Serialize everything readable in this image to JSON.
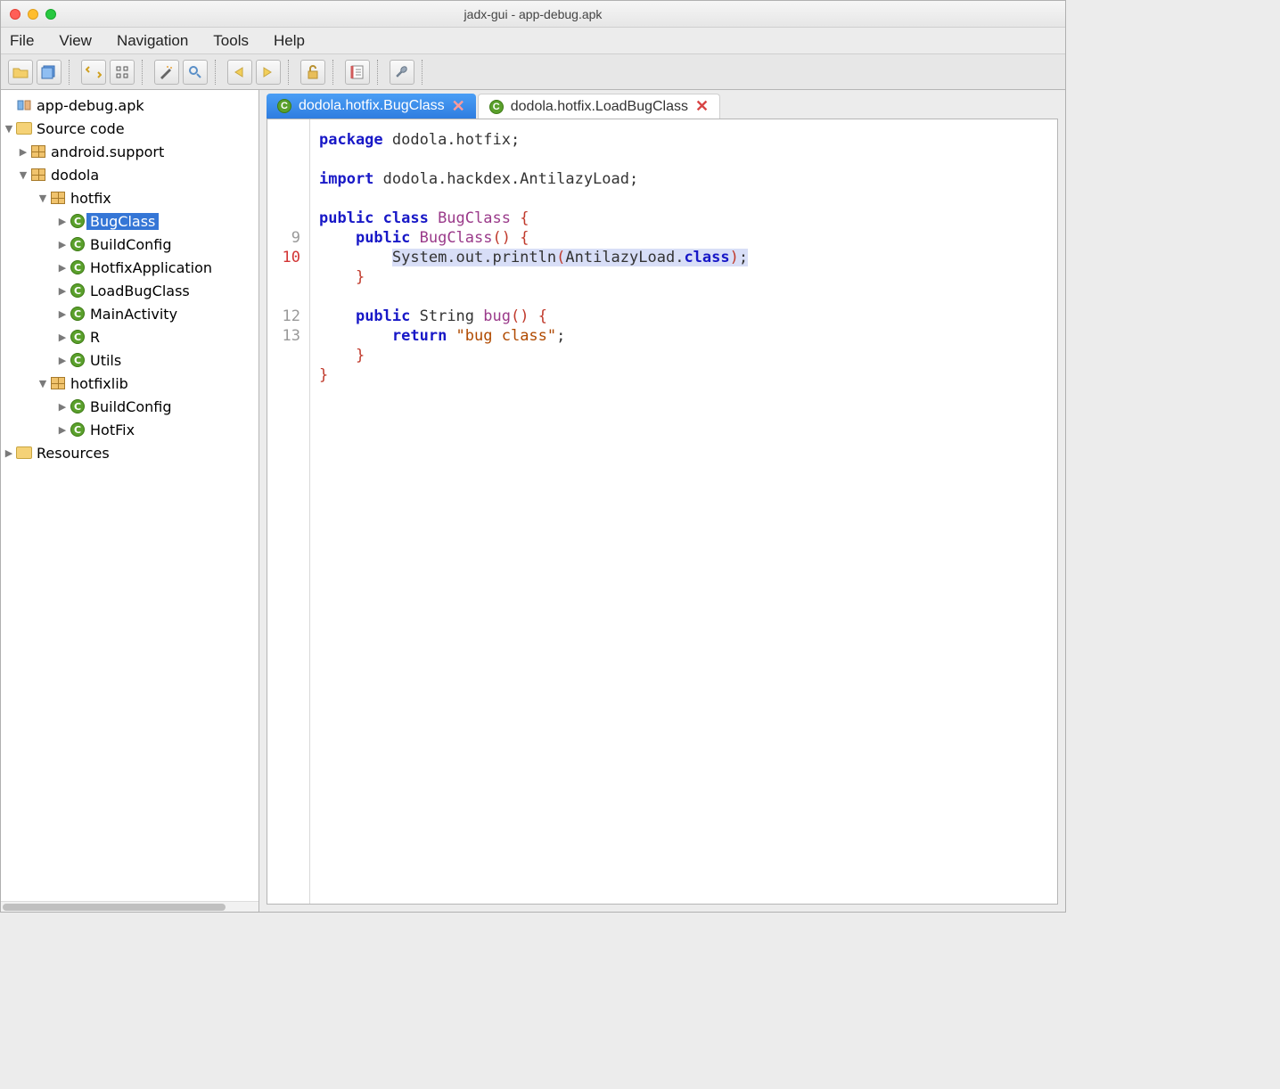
{
  "window": {
    "title": "jadx-gui - app-debug.apk"
  },
  "menu": {
    "file": "File",
    "view": "View",
    "navigation": "Navigation",
    "tools": "Tools",
    "help": "Help"
  },
  "tree": {
    "root": "app-debug.apk",
    "sourceCode": "Source code",
    "resources": "Resources",
    "packages": {
      "androidSupport": "android.support",
      "dodola": "dodola",
      "hotfix": "hotfix",
      "hotfixlib": "hotfixlib"
    },
    "classes": {
      "BugClass": "BugClass",
      "BuildConfig": "BuildConfig",
      "HotfixApplication": "HotfixApplication",
      "LoadBugClass": "LoadBugClass",
      "MainActivity": "MainActivity",
      "R": "R",
      "Utils": "Utils",
      "BuildConfig2": "BuildConfig",
      "HotFix": "HotFix"
    }
  },
  "tabs": {
    "active": "dodola.hotfix.BugClass",
    "inactive": "dodola.hotfix.LoadBugClass"
  },
  "code": {
    "packageLine": {
      "kw": "package",
      "pkg": " dodola.hotfix;"
    },
    "importLine": {
      "kw": "import",
      "imp": " dodola.hackdex.AntilazyLoad;"
    },
    "classDecl": {
      "mods": "public class ",
      "name": "BugClass",
      "open": " {"
    },
    "ctorDecl": {
      "pad": "    ",
      "mods": "public ",
      "name": "BugClass",
      "sig": "() {"
    },
    "ctorBody": {
      "pad": "        ",
      "pre": "System.out.println",
      "lparen": "(",
      "arg": "AntilazyLoad.",
      "cls": "class",
      "rparen": ")",
      "semi": ";"
    },
    "ctorEnd": "    }",
    "methodDecl": {
      "pad": "    ",
      "mods": "public ",
      "type": "String ",
      "name": "bug",
      "sig": "() {"
    },
    "returnLine": {
      "pad": "        ",
      "kw": "return ",
      "str": "\"bug class\"",
      "semi": ";"
    },
    "methodEnd": "    }",
    "classEnd": "}",
    "gutter": {
      "l9": "9",
      "l10": "10",
      "l12": "12",
      "l13": "13"
    }
  }
}
